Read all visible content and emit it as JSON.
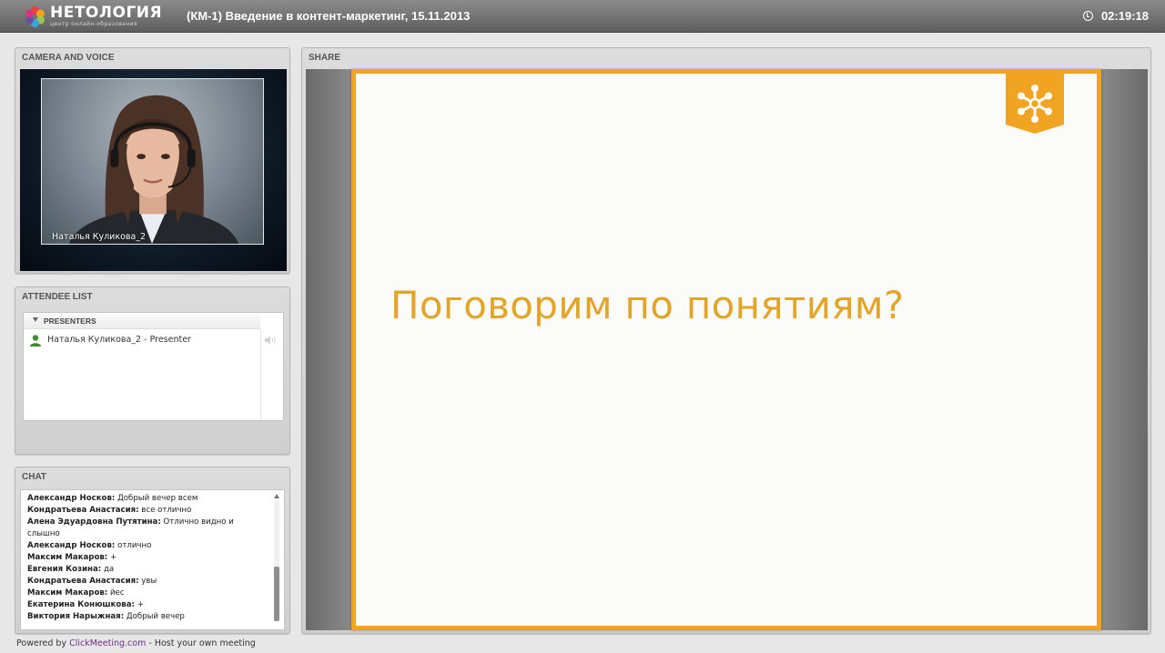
{
  "header": {
    "logo_name": "НЕТОЛОГИЯ",
    "logo_tagline": "центр онлайн-образования",
    "meeting_title": "(КМ-1) Введение в контент-маркетинг, 15.11.2013",
    "timer": "02:19:18"
  },
  "camera": {
    "title": "CAMERA AND VOICE",
    "video_label": "Наталья Куликова_2"
  },
  "attendees": {
    "title": "ATTENDEE LIST",
    "group_label": "PRESENTERS",
    "items": [
      {
        "name": "Наталья Куликова_2 - Presenter"
      }
    ]
  },
  "chat": {
    "title": "CHAT",
    "messages": [
      {
        "author": "Александр Носков:",
        "text": "Добрый вечер всем"
      },
      {
        "author": "Кондратьева Анастасия:",
        "text": "все отлично"
      },
      {
        "author": "Алена Эдуардовна Путятина:",
        "text": "Отлично видно и слышно"
      },
      {
        "author": "Александр Носков:",
        "text": "отлично"
      },
      {
        "author": "Максим Макаров:",
        "text": "+"
      },
      {
        "author": "Евгения Козина:",
        "text": "да"
      },
      {
        "author": "Кондратьева Анастасия:",
        "text": "увы"
      },
      {
        "author": "Максим Макаров:",
        "text": "йес"
      },
      {
        "author": "Екатерина Конюшкова:",
        "text": "+"
      },
      {
        "author": "Виктория Нарыжная:",
        "text": "Добрый вечер"
      }
    ]
  },
  "share": {
    "title": "SHARE",
    "slide_heading": "Поговорим по понятиям?"
  },
  "footer": {
    "prefix": "Powered by",
    "link": "ClickMeeting.com",
    "suffix": "- Host your own meeting"
  },
  "colors": {
    "accent_orange": "#f0a422",
    "slide_text": "#e3a42a",
    "footer_link": "#6a2c84",
    "presenter_icon": "#3f8d2e"
  }
}
